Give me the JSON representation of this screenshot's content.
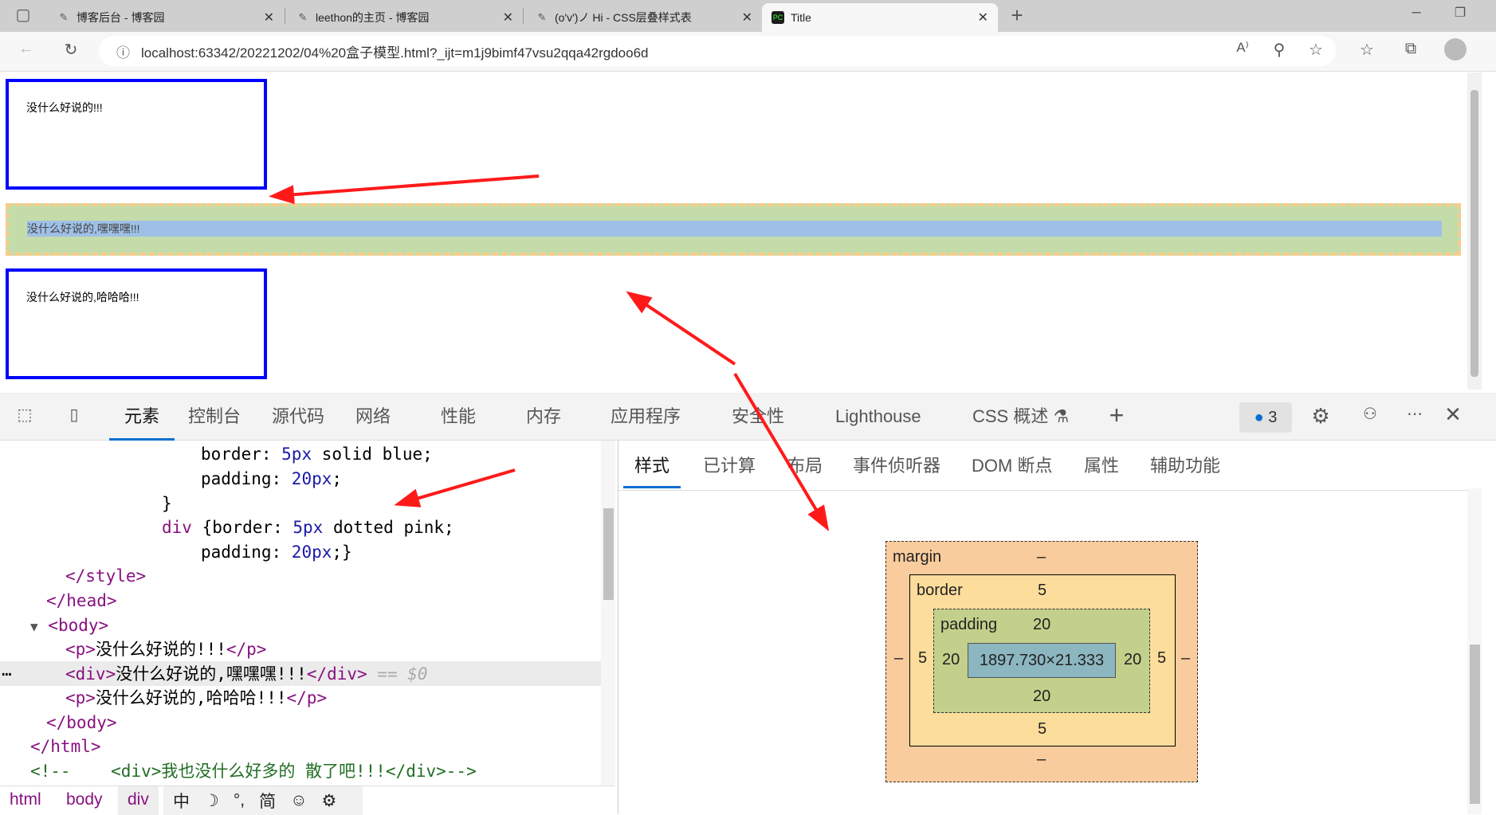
{
  "browser": {
    "tabs": [
      {
        "title": "博客后台 - 博客园",
        "active": false
      },
      {
        "title": "leethon的主页 - 博客园",
        "active": false
      },
      {
        "title": "(o'v')ノ Hi - CSS层叠样式表",
        "active": false
      },
      {
        "title": "Title",
        "active": true
      }
    ],
    "url": "localhost:63342/20221202/04%20盒子模型.html?_ijt=m1j9bimf47vsu2qqa42rgdoo6d"
  },
  "page": {
    "p1": "没什么好说的!!!",
    "div": "没什么好说的,嘿嘿嘿!!!",
    "p2": "没什么好说的,哈哈哈!!!"
  },
  "devtools": {
    "tabs": [
      "元素",
      "控制台",
      "源代码",
      "网络",
      "性能",
      "内存",
      "应用程序",
      "安全性",
      "Lighthouse",
      "CSS 概述"
    ],
    "issues_count": "3",
    "code": {
      "l1a": "border: ",
      "l1b": "5px",
      "l1c": " solid blue;",
      "l2a": "padding: ",
      "l2b": "20px",
      ";": ";",
      "l3": "}",
      "l4a": "div ",
      "l4b": "{border: ",
      "l4c": "5px",
      "l4d": " dotted pink;",
      "l5a": "padding: ",
      "l5b": "20px",
      "l5c": ";}",
      "l6": "</style>",
      "l7": "</head>",
      "l8": "<body>",
      "l9a": "<p>",
      "l9b": "没什么好说的!!!",
      "l9c": "</p>",
      "l10a": "<div>",
      "l10b": "没什么好说的,嘿嘿嘿!!!",
      "l10c": "</div>",
      "l10d": " == $0",
      "l11a": "<p>",
      "l11b": "没什么好说的,哈哈哈!!!",
      "l11c": "</p>",
      "l12": "</body>",
      "l13": "</html>",
      "l14": "<!--    <div>我也没什么好多的 散了吧!!!</div>-->"
    },
    "breadcrumb": [
      "html",
      "body",
      "div"
    ],
    "ime": [
      "中",
      "☽",
      "°,",
      "简",
      "☺",
      "⚙"
    ],
    "style_tabs": [
      "样式",
      "已计算",
      "布局",
      "事件侦听器",
      "DOM 断点",
      "属性",
      "辅助功能"
    ],
    "box_model": {
      "margin_label": "margin",
      "margin": "–",
      "border_label": "border",
      "border": "5",
      "padding_label": "padding",
      "padding": "20",
      "content": "1897.730×21.333"
    }
  },
  "colors": {
    "accent": "#0a6ed1",
    "p_border": "#0000ff",
    "arrow": "#ff1a1a",
    "margin": "#f9cc9d",
    "border": "#fddd9b",
    "padding": "#c3d08b",
    "content": "#8cb6c0"
  }
}
